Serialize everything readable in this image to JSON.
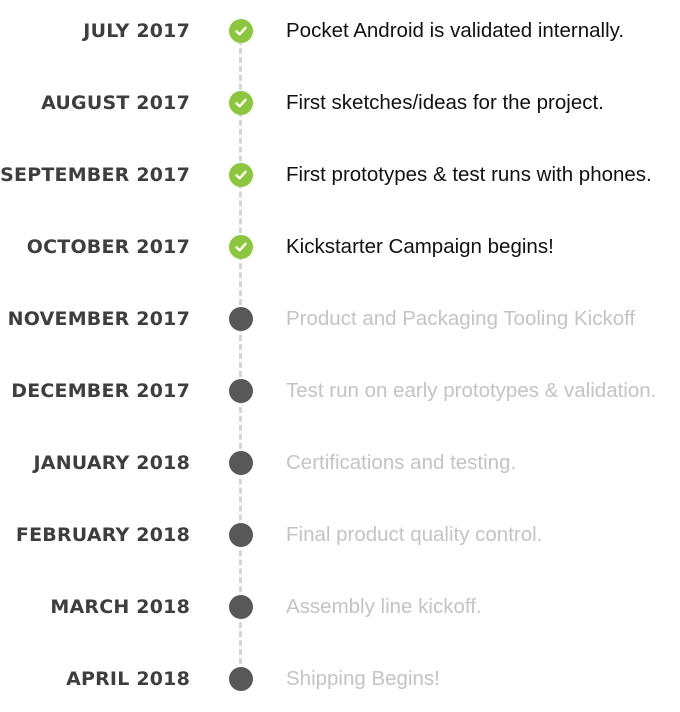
{
  "accent_color": "#8cc63f",
  "pending_color": "#585858",
  "milestones": [
    {
      "date": "JULY 2017",
      "text": "Pocket Android is validated internally.",
      "status": "done",
      "icon": "check-icon"
    },
    {
      "date": "AUGUST 2017",
      "text": "First sketches/ideas for the project.",
      "status": "done",
      "icon": "check-icon"
    },
    {
      "date": "SEPTEMBER 2017",
      "text": "First prototypes & test runs with phones.",
      "status": "done",
      "icon": "check-icon"
    },
    {
      "date": "OCTOBER 2017",
      "text": "Kickstarter Campaign begins!",
      "status": "done",
      "icon": "check-icon"
    },
    {
      "date": "NOVEMBER 2017",
      "text": "Product and Packaging Tooling Kickoff",
      "status": "pending",
      "icon": "dot-icon"
    },
    {
      "date": "DECEMBER 2017",
      "text": "Test run on early prototypes & validation.",
      "status": "pending",
      "icon": "dot-icon"
    },
    {
      "date": "JANUARY 2018",
      "text": "Certifications and testing.",
      "status": "pending",
      "icon": "dot-icon"
    },
    {
      "date": "FEBRUARY 2018",
      "text": "Final product quality control.",
      "status": "pending",
      "icon": "dot-icon"
    },
    {
      "date": "MARCH 2018",
      "text": "Assembly line kickoff.",
      "status": "pending",
      "icon": "dot-icon"
    },
    {
      "date": "APRIL 2018",
      "text": "Shipping Begins!",
      "status": "pending",
      "icon": "dot-icon"
    }
  ]
}
